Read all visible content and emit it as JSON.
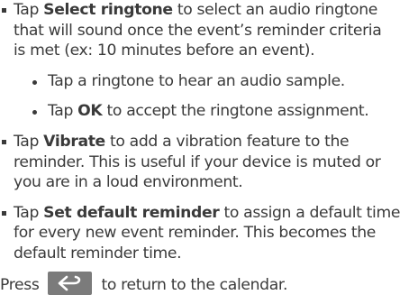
{
  "items": [
    {
      "prefix": "Tap ",
      "bold": "Select ringtone",
      "line1_rest": " to select an audio ringtone",
      "line2": "that will sound once the event’s reminder criteria",
      "line3": "is met (ex: 10 minutes before an event)."
    },
    {
      "prefix": "Tap ",
      "bold": "Vibrate",
      "line1_rest": " to add a vibration feature to the",
      "line2": "reminder. This is useful if your device is muted or",
      "line3": "you are in a loud environment."
    },
    {
      "prefix": "Tap ",
      "bold": "Set default reminder",
      "line1_rest": " to assign a default time",
      "line2": "for every new event reminder. This becomes the",
      "line3": "default reminder time."
    }
  ],
  "subitems": [
    {
      "text": "Tap a ringtone to hear an audio sample."
    },
    {
      "prefix": "Tap ",
      "bold": "OK",
      "rest": " to accept the ringtone assignment."
    }
  ],
  "press": {
    "before": "Press",
    "after": "to return to the calendar.",
    "key_icon": "back-arrow-icon"
  },
  "colors": {
    "text": "#3a3a3a",
    "key_background": "#7b7b7b",
    "key_glyph": "#ffffff"
  }
}
